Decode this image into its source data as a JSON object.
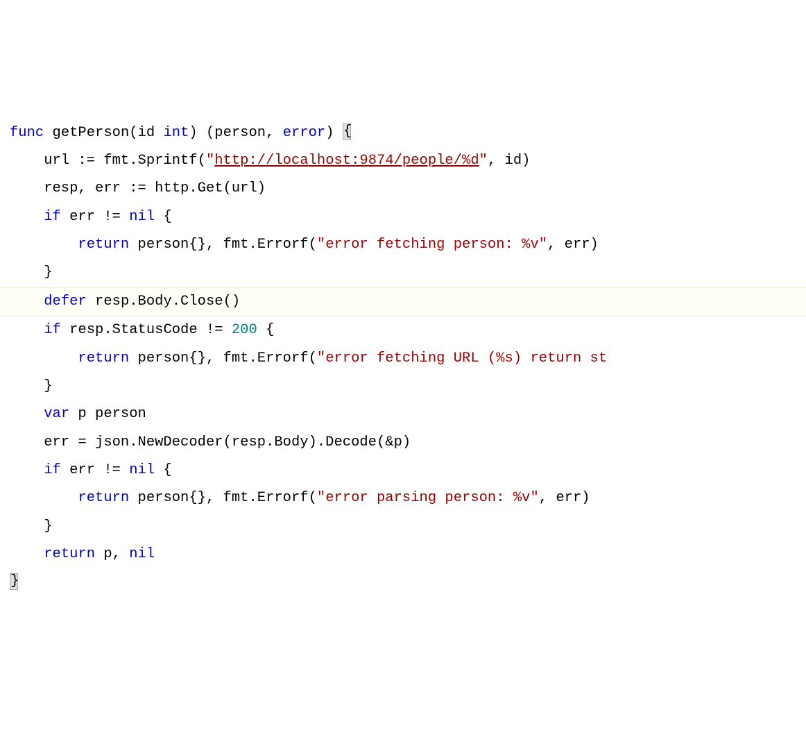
{
  "colors": {
    "keyword": "#0000c0",
    "type": "#008080",
    "number": "#008080",
    "string": "#980000",
    "plain": "#000000",
    "guide": "#d0d0d0",
    "background": "#ffffff",
    "currentLine": "#fffff8"
  },
  "code": {
    "line1": {
      "k_func": "func",
      "fn_name": "getPerson",
      "p_open": "(id ",
      "k_int": "int",
      "p_close": ") (person, ",
      "k_error": "error",
      "p_end": ") ",
      "brace": "{"
    },
    "line2": {
      "prefix": "    url := fmt.Sprintf(",
      "q1": "\"",
      "url": "http://localhost:9874/people/%d",
      "q2": "\"",
      "suffix": ", id)"
    },
    "line3": "    resp, err := http.Get(url)",
    "line4": {
      "pre": "    ",
      "k_if": "if",
      "mid": " err != ",
      "k_nil": "nil",
      "end": " {"
    },
    "line5": {
      "pre": "        ",
      "k_return": "return",
      "mid": " person{}, fmt.Errorf(",
      "str": "\"error fetching person: %v\"",
      "end": ", err)"
    },
    "line6": "    }",
    "line7": {
      "pre": "    ",
      "k_defer": "defer",
      "rest": " resp.Body.Close()"
    },
    "line8": {
      "pre": "    ",
      "k_if": "if",
      "mid": " resp.StatusCode != ",
      "num": "200",
      "end": " {"
    },
    "line9": {
      "pre": "        ",
      "k_return": "return",
      "mid": " person{}, fmt.Errorf(",
      "str": "\"error fetching URL (%s) return st"
    },
    "line10": "    }",
    "line11": {
      "pre": "    ",
      "k_var": "var",
      "rest": " p person"
    },
    "line12": "    err = json.NewDecoder(resp.Body).Decode(&p)",
    "line13": {
      "pre": "    ",
      "k_if": "if",
      "mid": " err != ",
      "k_nil": "nil",
      "end": " {"
    },
    "line14": {
      "pre": "        ",
      "k_return": "return",
      "mid": " person{}, fmt.Errorf(",
      "str": "\"error parsing person: %v\"",
      "end": ", err)"
    },
    "line15": "    }",
    "line16": {
      "pre": "    ",
      "k_return": "return",
      "mid": " p, ",
      "k_nil": "nil"
    },
    "line17": "}"
  }
}
